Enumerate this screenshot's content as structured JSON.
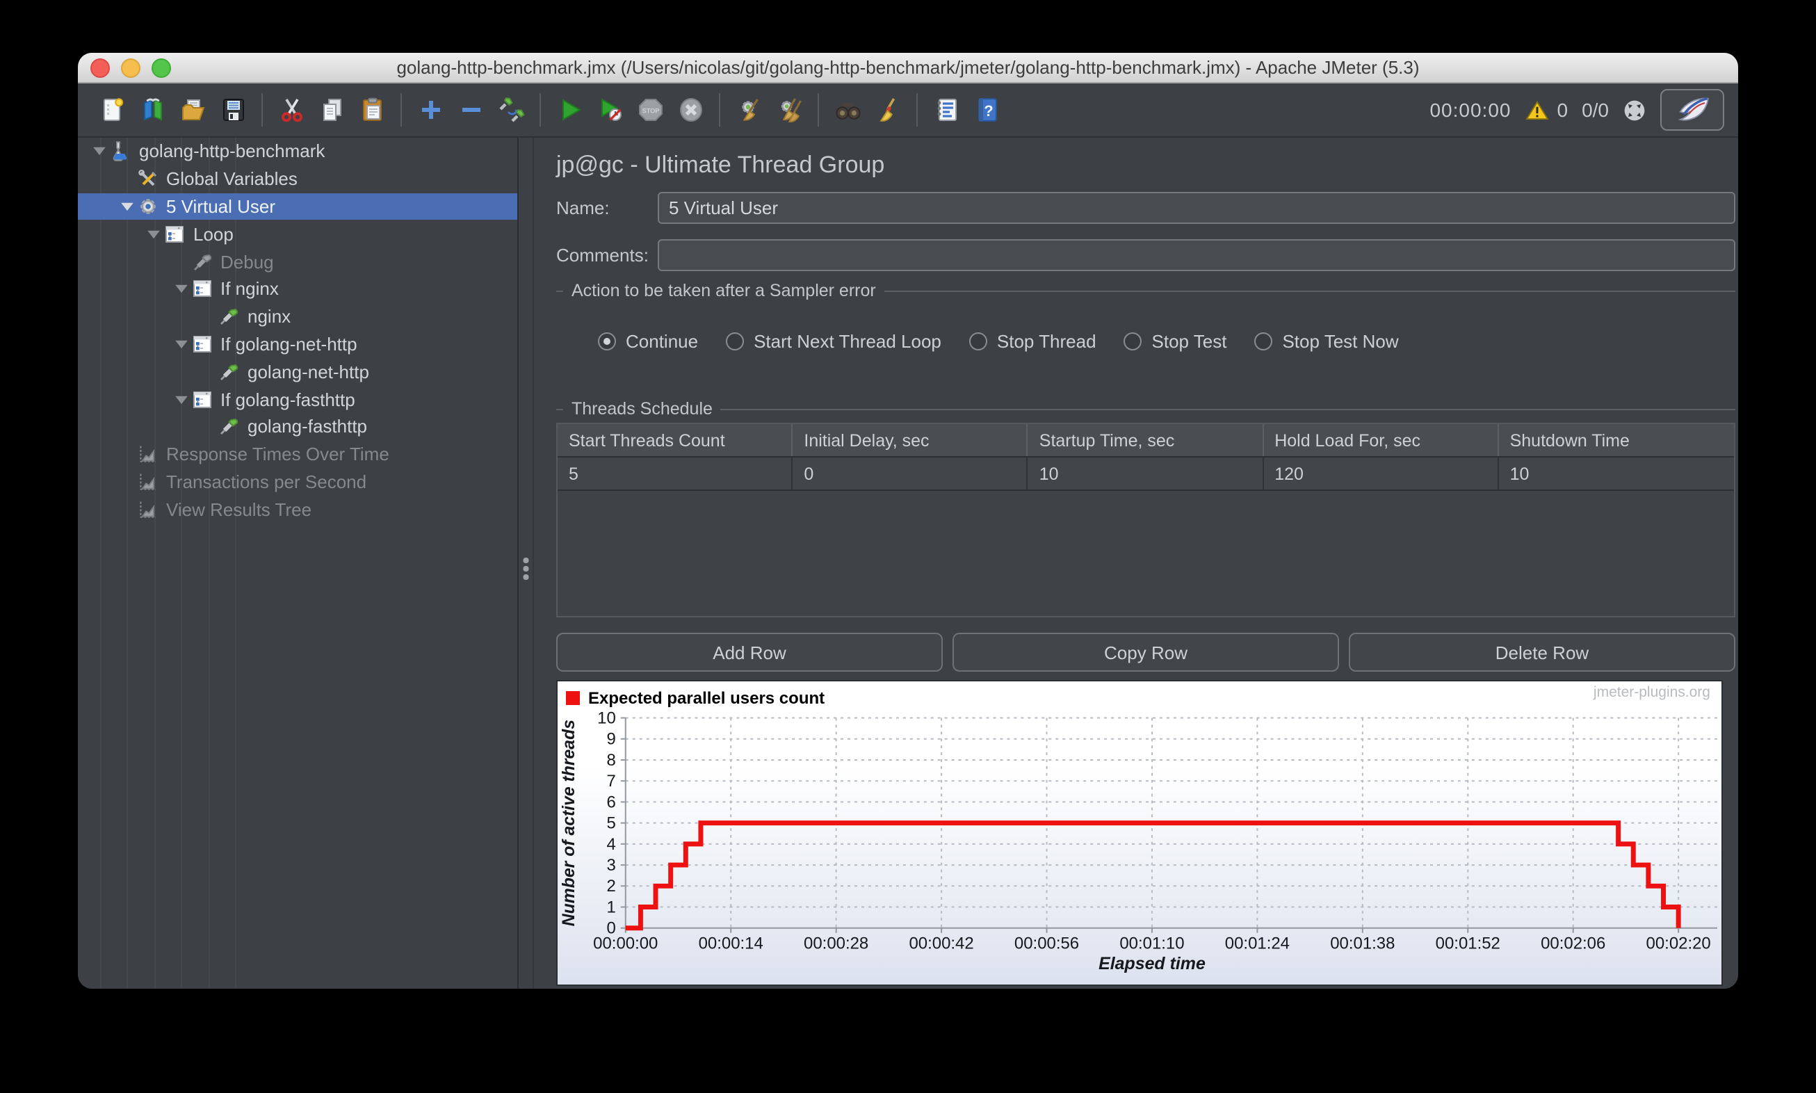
{
  "window": {
    "title": "golang-http-benchmark.jmx (/Users/nicolas/git/golang-http-benchmark/jmeter/golang-http-benchmark.jmx) - Apache JMeter (5.3)"
  },
  "toolbar": {
    "items": [
      "new-file",
      "templates",
      "open-file",
      "save",
      "|",
      "cut",
      "copy",
      "paste",
      "|",
      "expand-all",
      "collapse-all",
      "toggle-elements",
      "|",
      "start",
      "start-no-pauses",
      "stop",
      "shutdown",
      "|",
      "clear",
      "clear-all",
      "|",
      "search",
      "search-reset",
      "|",
      "function-helper",
      "help"
    ],
    "timer": "00:00:00",
    "warning_count": "0",
    "thread_count": "0/0"
  },
  "tree": {
    "items": [
      {
        "label": "golang-http-benchmark",
        "level": 0,
        "icon": "test-plan",
        "expanded": true
      },
      {
        "label": "Global Variables",
        "level": 1,
        "icon": "arguments"
      },
      {
        "label": "5 Virtual User",
        "level": 1,
        "icon": "thread-group",
        "expanded": true,
        "selected": true
      },
      {
        "label": "Loop",
        "level": 2,
        "icon": "controller",
        "expanded": true
      },
      {
        "label": "Debug",
        "level": 3,
        "icon": "sampler-disabled",
        "disabled": true
      },
      {
        "label": "If nginx",
        "level": 3,
        "icon": "controller",
        "expanded": true
      },
      {
        "label": "nginx",
        "level": 4,
        "icon": "sampler"
      },
      {
        "label": "If golang-net-http",
        "level": 3,
        "icon": "controller",
        "expanded": true
      },
      {
        "label": "golang-net-http",
        "level": 4,
        "icon": "sampler"
      },
      {
        "label": "If golang-fasthttp",
        "level": 3,
        "icon": "controller",
        "expanded": true
      },
      {
        "label": "golang-fasthttp",
        "level": 4,
        "icon": "sampler"
      },
      {
        "label": "Response Times Over Time",
        "level": 1,
        "icon": "listener",
        "disabled": true
      },
      {
        "label": "Transactions per Second",
        "level": 1,
        "icon": "listener",
        "disabled": true
      },
      {
        "label": "View Results Tree",
        "level": 1,
        "icon": "listener",
        "disabled": true
      }
    ]
  },
  "main": {
    "title": "jp@gc - Ultimate Thread Group",
    "name_label": "Name:",
    "name_value": "5 Virtual User",
    "comments_label": "Comments:",
    "comments_value": "",
    "error_action": {
      "section_title": "Action to be taken after a Sampler error",
      "options": [
        {
          "label": "Continue",
          "selected": true
        },
        {
          "label": "Start Next Thread Loop",
          "selected": false
        },
        {
          "label": "Stop Thread",
          "selected": false
        },
        {
          "label": "Stop Test",
          "selected": false
        },
        {
          "label": "Stop Test Now",
          "selected": false
        }
      ]
    },
    "threads_schedule": {
      "section_title": "Threads Schedule",
      "columns": [
        "Start Threads Count",
        "Initial Delay, sec",
        "Startup Time, sec",
        "Hold Load For, sec",
        "Shutdown Time"
      ],
      "rows": [
        [
          "5",
          "0",
          "10",
          "120",
          "10"
        ]
      ],
      "buttons": [
        "Add Row",
        "Copy Row",
        "Delete Row"
      ]
    }
  },
  "chart_data": {
    "type": "line",
    "step": true,
    "title": "",
    "legend": [
      {
        "label": "Expected parallel users count",
        "color": "#ee1111"
      }
    ],
    "watermark": "jmeter-plugins.org",
    "xlabel": "Elapsed time",
    "ylabel": "Number of active threads",
    "xlim": [
      0,
      140
    ],
    "ylim": [
      0,
      10
    ],
    "y_ticks": [
      0,
      1,
      2,
      3,
      4,
      5,
      6,
      7,
      8,
      9,
      10
    ],
    "x_ticks": [
      {
        "t": 0,
        "label": "00:00:00"
      },
      {
        "t": 14,
        "label": "00:00:14"
      },
      {
        "t": 28,
        "label": "00:00:28"
      },
      {
        "t": 42,
        "label": "00:00:42"
      },
      {
        "t": 56,
        "label": "00:00:56"
      },
      {
        "t": 70,
        "label": "00:01:10"
      },
      {
        "t": 84,
        "label": "00:01:24"
      },
      {
        "t": 98,
        "label": "00:01:38"
      },
      {
        "t": 112,
        "label": "00:01:52"
      },
      {
        "t": 126,
        "label": "00:02:06"
      },
      {
        "t": 140,
        "label": "00:02:20"
      }
    ],
    "series": [
      {
        "name": "Expected parallel users count",
        "color": "#ee1111",
        "points": [
          [
            0,
            0
          ],
          [
            2,
            1
          ],
          [
            4,
            2
          ],
          [
            6,
            3
          ],
          [
            8,
            4
          ],
          [
            10,
            5
          ],
          [
            132,
            4
          ],
          [
            134,
            3
          ],
          [
            136,
            2
          ],
          [
            138,
            1
          ],
          [
            140,
            0
          ]
        ]
      }
    ],
    "grid": true,
    "legend_position": "top-left"
  }
}
